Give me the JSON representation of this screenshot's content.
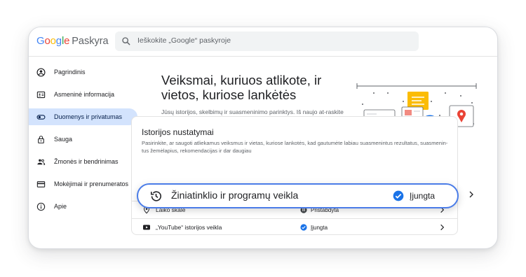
{
  "header": {
    "logo_google": [
      "G",
      "o",
      "o",
      "g",
      "l",
      "e"
    ],
    "logo_colors": [
      "#4285F4",
      "#EA4335",
      "#FBBC05",
      "#4285F4",
      "#34A853",
      "#EA4335"
    ],
    "product": "Paskyra",
    "search_placeholder": "Ieškokite „Google“ paskyroje"
  },
  "sidebar": {
    "items": [
      {
        "label": "Pagrindinis",
        "icon": "account-circle-icon"
      },
      {
        "label": "Asmeninė informacija",
        "icon": "badge-icon"
      },
      {
        "label": "Duomenys ir privatumas",
        "icon": "toggle-icon",
        "active": true
      },
      {
        "label": "Sauga",
        "icon": "lock-icon"
      },
      {
        "label": "Žmonės ir bendrinimas",
        "icon": "people-icon"
      },
      {
        "label": "Mokėjimai ir prenumeratos",
        "icon": "credit-card-icon"
      },
      {
        "label": "Apie",
        "icon": "info-icon"
      }
    ]
  },
  "main": {
    "title": "Veiksmai, kuriuos atlikote, ir vietos, kuriose lankėtės",
    "description": "Jūsų istorijos, skelbimų ir suasmeninimo parinktys. Iš naujo at-raskite tai, ko ieškojote, ką skaitėte ir žiūrėjote, ir peržiūrėkite vietas, kuriose lankėtės."
  },
  "history_card": {
    "title": "Istorijos nustatymai",
    "description": "Pasirinkite, ar saugoti atliekamus veiksmus ir vietas, kuriose lankotės, kad gautumėte labiau suasmenintus rezultatus, suasmenin-tus žemėlapius, rekomendacijas ir dar daugiau",
    "highlight": {
      "label": "Žiniatinklio ir programų veikla",
      "status": "Įjungta",
      "icon": "history-icon"
    },
    "rows": [
      {
        "label": "Laiko skalė",
        "status": "Pristabdyta",
        "icon": "location-pin-icon",
        "status_icon": "paused-icon"
      },
      {
        "label": "„YouTube“ istorijos veikla",
        "status": "Įjungta",
        "icon": "youtube-icon",
        "status_icon": "check-circle-icon"
      }
    ]
  },
  "colors": {
    "accent": "#4a7ce8",
    "active_nav": "#d3e3fd",
    "check": "#1a73e8"
  }
}
